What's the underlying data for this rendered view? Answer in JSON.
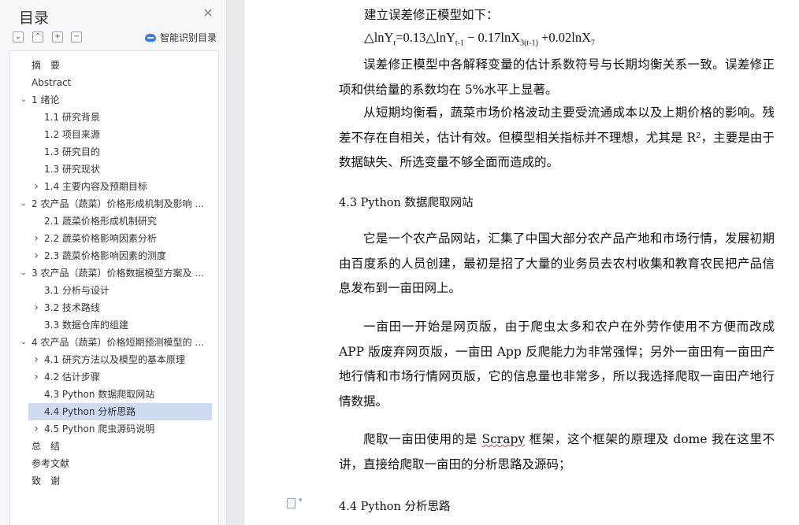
{
  "outline_panel": {
    "title": "目录",
    "close_icon": "close-icon",
    "tool_buttons": [
      {
        "name": "expand-all-button",
        "glyph": "⌄"
      },
      {
        "name": "collapse-all-button",
        "glyph": "⌃"
      },
      {
        "name": "add-heading-button",
        "glyph": "+"
      },
      {
        "name": "remove-heading-button",
        "glyph": "−"
      }
    ],
    "smart_label": "智能识别目录",
    "smart_icon": "cloud-icon",
    "items": [
      {
        "label": "摘　要",
        "level": 0,
        "arrow": "none"
      },
      {
        "label": "Abstract",
        "level": 0,
        "arrow": "none"
      },
      {
        "label": "1 绪论",
        "level": 0,
        "arrow": "down"
      },
      {
        "label": "1.1 研究背景",
        "level": 1,
        "arrow": "none"
      },
      {
        "label": "1.2 项目来源",
        "level": 1,
        "arrow": "none"
      },
      {
        "label": "1.3 研究目的",
        "level": 1,
        "arrow": "none"
      },
      {
        "label": "1.3 研究现状",
        "level": 1,
        "arrow": "none"
      },
      {
        "label": "1.4 主要内容及预期目标",
        "level": 1,
        "arrow": "right"
      },
      {
        "label": "2 农产品（蔬菜）价格形成机制及影响 ...",
        "level": 0,
        "arrow": "down"
      },
      {
        "label": "2.1 蔬菜价格形成机制研究",
        "level": 1,
        "arrow": "none"
      },
      {
        "label": "2.2 蔬菜价格影响因素分析",
        "level": 1,
        "arrow": "right"
      },
      {
        "label": "2.3 蔬菜价格影响因素的测度",
        "level": 1,
        "arrow": "right"
      },
      {
        "label": "3 农产品（蔬菜）价格数据模型方案及 ...",
        "level": 0,
        "arrow": "down"
      },
      {
        "label": "3.1 分析与设计",
        "level": 1,
        "arrow": "none"
      },
      {
        "label": "3.2 技术路线",
        "level": 1,
        "arrow": "right"
      },
      {
        "label": "3.3 数据仓库的组建",
        "level": 1,
        "arrow": "none"
      },
      {
        "label": "4 农产品（蔬菜）价格短期预测模型的 ...",
        "level": 0,
        "arrow": "down"
      },
      {
        "label": "4.1  研究方法以及模型的基本原理",
        "level": 1,
        "arrow": "right"
      },
      {
        "label": "4.2  估计步骤",
        "level": 1,
        "arrow": "right"
      },
      {
        "label": "4.3 Python 数据爬取网站",
        "level": 1,
        "arrow": "none"
      },
      {
        "label": "4.4 Python 分析思路",
        "level": 1,
        "arrow": "none",
        "selected": true
      },
      {
        "label": "4.5 Python 爬虫源码说明",
        "level": 1,
        "arrow": "right"
      },
      {
        "label": "总　结",
        "level": 0,
        "arrow": "none"
      },
      {
        "label": "参考文献",
        "level": 0,
        "arrow": "none"
      },
      {
        "label": "致　谢",
        "level": 0,
        "arrow": "none"
      }
    ]
  },
  "document": {
    "intro": "建立误差修正模型如下：",
    "formula": {
      "p1": "△lnY",
      "s1": "t",
      "p2": "=0.13△lnY",
      "s2": "t-1",
      "p3": " − 0.17lnX",
      "s3": "3(t-1)",
      "p4": " +0.02lnX",
      "s4": "7"
    },
    "para1": "误差修正模型中各解释变量的估计系数符号与长期均衡关系一致。误差修正项和供给量的系数均在 5%水平上显著。",
    "para2": "从短期均衡看，蔬菜市场价格波动主要受流通成本以及上期价格的影响。残差不存在自相关，估计有效。但模型相关指标并不理想，尤其是 R²，主要是由于数据缺失、所选变量不够全面而造成的。",
    "heading_43": "4.3 Python 数据爬取网站",
    "para3": "它是一个农产品网站，汇集了中国大部分农产品产地和市场行情，发展初期由百度系的人员创建，最初是招了大量的业务员去农村收集和教育农民把产品信息发布到一亩田网上。",
    "para4": "一亩田一开始是网页版，由于爬虫太多和农户在外劳作使用不方便而改成 APP 版废弃网页版，一亩田 App 反爬能力为非常强悍；另外一亩田有一亩田产地行情和市场行情网页版，它的信息量也非常多，所以我选择爬取一亩田产地行情数据。",
    "para5_a": "爬取一亩田使用的是 ",
    "para5_scrapy": "Scrapy",
    "para5_b": " 框架，这个框架的原理及 dome 我在这里不讲，直接给爬取一亩田的分析思路及源码；",
    "heading_44": "4.4 Python 分析思路",
    "paragraph_marker_icon": "document-icon"
  }
}
